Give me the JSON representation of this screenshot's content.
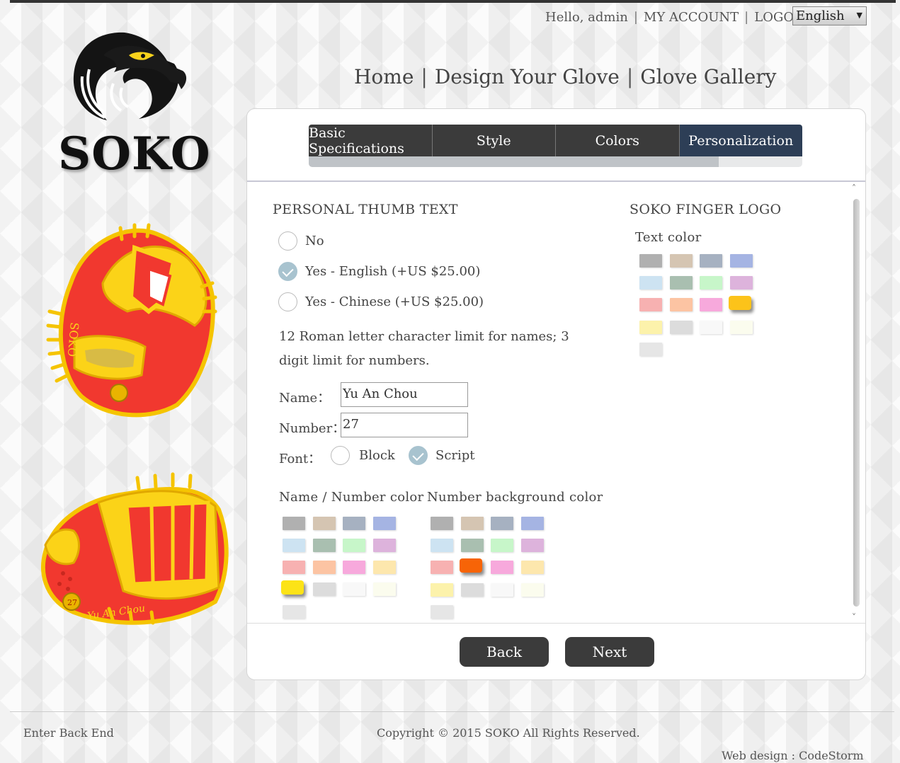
{
  "header": {
    "greeting": "Hello, admin",
    "my_account": "MY ACCOUNT",
    "logout": "LOGOUT",
    "language": "English",
    "language_arrow": "▼"
  },
  "logo": {
    "text": "SOKO"
  },
  "nav": {
    "home": "Home",
    "design": "Design Your Glove",
    "gallery": "Glove Gallery"
  },
  "tabs": [
    {
      "label": "Basic Specifications"
    },
    {
      "label": "Style"
    },
    {
      "label": "Colors"
    },
    {
      "label": "Personalization",
      "active": true
    }
  ],
  "progress_percent": 83,
  "thumb_text": {
    "title": "PERSONAL THUMB TEXT",
    "options": [
      {
        "label": "No",
        "checked": false
      },
      {
        "label": "Yes - English (+US $25.00)",
        "checked": true
      },
      {
        "label": "Yes - Chinese (+US $25.00)",
        "checked": false
      }
    ],
    "note": "12 Roman letter character limit for names; 3 digit limit for numbers.",
    "name_label": "Name：",
    "name_value": "Yu An Chou",
    "number_label": "Number：",
    "number_value": "27",
    "font_label": "Font：",
    "font_options": [
      {
        "label": "Block",
        "checked": false
      },
      {
        "label": "Script",
        "checked": true
      }
    ]
  },
  "name_number_color": {
    "title": "Name / Number color",
    "swatches": [
      "#b0b0b0",
      "#d5c5b2",
      "#a6b1c1",
      "#a5b4e3",
      "#cde3f2",
      "#a9bfb0",
      "#c7f6c9",
      "#ddb3dc",
      "#f7b1b1",
      "#fcc4a3",
      "#f7a9dc",
      "#fde7ad",
      "#fce317",
      "#dcdcdc",
      "#f8f8f8",
      "#fbfcee",
      "#e6e6e6"
    ],
    "selected": 12
  },
  "number_bg_color": {
    "title": "Number background color",
    "swatches": [
      "#b0b0b0",
      "#d5c5b2",
      "#a6b1c1",
      "#a5b4e3",
      "#cde3f2",
      "#a9bfb0",
      "#c7f6c9",
      "#ddb3dc",
      "#f7b1b1",
      "#f76407",
      "#f7a9dc",
      "#fde7ad",
      "#fcf2ab",
      "#dcdcdc",
      "#f8f8f8",
      "#fbfcee",
      "#e6e6e6"
    ],
    "selected": 9
  },
  "finger_logo": {
    "title": "SOKO FINGER LOGO",
    "text_color_label": "Text color",
    "swatches": [
      "#b0b0b0",
      "#d5c5b2",
      "#a6b1c1",
      "#a5b4e3",
      "#cde3f2",
      "#a9bfb0",
      "#c7f6c9",
      "#ddb3dc",
      "#f7b1b1",
      "#fcc4a3",
      "#f7a9dc",
      "#fcc31a",
      "#fcf2ab",
      "#dcdcdc",
      "#f8f8f8",
      "#fbfcee",
      "#e6e6e6"
    ],
    "selected": 11
  },
  "buttons": {
    "back": "Back",
    "next": "Next"
  },
  "scroll_icons": {
    "up": "˄",
    "down": "˅"
  },
  "glove_print": {
    "number": "27",
    "name": "Yu An Chou",
    "brand": "SOKO"
  },
  "footer": {
    "back_end": "Enter Back End",
    "copyright": "Copyright © 2015 SOKO All Rights Reserved.",
    "credit": "Web design : CodeStorm Studio"
  }
}
